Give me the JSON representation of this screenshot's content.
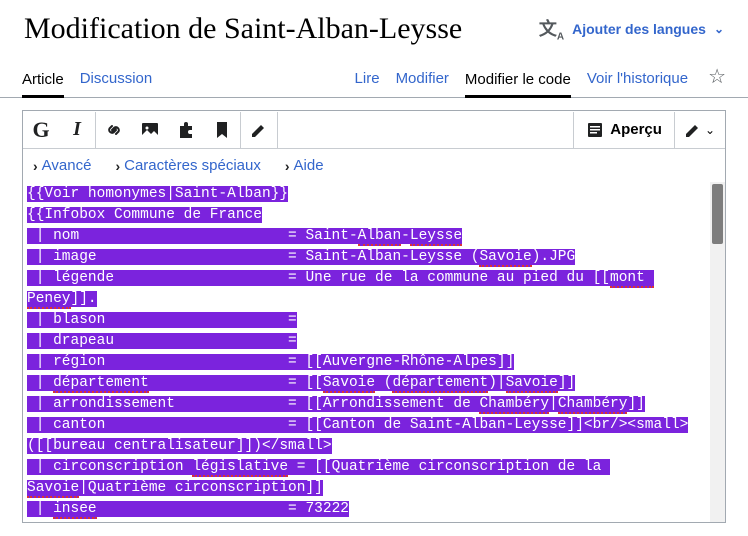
{
  "header": {
    "title": "Modification de Saint-Alban-Leysse",
    "lang_label": "Ajouter des langues"
  },
  "tabs": {
    "article": "Article",
    "discussion": "Discussion",
    "lire": "Lire",
    "modifier": "Modifier",
    "modifier_code": "Modifier le code",
    "historique": "Voir l'historique"
  },
  "toolbar": {
    "bold": "G",
    "italic": "I",
    "preview": "Aperçu"
  },
  "subtoolbar": {
    "avance": "Avancé",
    "caracteres": "Caractères spéciaux",
    "aide": "Aide"
  },
  "code": {
    "l1": "{{Voir homonymes|Saint-Alban}}",
    "l2": "{{Infobox Commune de France",
    "l3a": " | nom                        = Saint-",
    "l3b": "Alban",
    "l3c": "-",
    "l3d": "Leysse",
    "l4a": " | image                      = Saint-Alban-Leysse (",
    "l4b": "Savoie",
    "l4c": ").JPG",
    "l5a": " | légende                    = Une rue de la commune au pied du [[",
    "l5b": "mont ",
    "l5c": "Peney",
    "l5d": "]].",
    "l6a": " | blason                     =",
    "l6b": " ",
    "l7a": " | drapeau                    =",
    "l7b": " ",
    "l8": " | région                     = [[Auvergne-Rhône-Alpes]]",
    "l9a": " | ",
    "l9b": "département",
    "l9c": "                = [[",
    "l9d": "Savoie",
    "l9e": " (",
    "l9f": "département",
    "l9g": ")|",
    "l9h": "Savoie",
    "l9i": "]]",
    "l10a": " | arrondissement             = [[Arrondissement de ",
    "l10b": "Chambéry",
    "l10c": "|",
    "l10d": "Chambéry",
    "l10e": "]]",
    "l11": " | canton                     = [[Canton de Saint-Alban-Leysse]]<br/><small>",
    "l11b": "([[bureau centralisateur]])</small>",
    "l12a": " | circonscription ",
    "l12b": "législative",
    "l12c": " = [[Quatrième circonscription de la ",
    "l12d": "Savoie",
    "l12e": "|Quatrième circonscription]]",
    "l13a": " | ",
    "l13b": "insee",
    "l13c": "                      = 73222"
  }
}
